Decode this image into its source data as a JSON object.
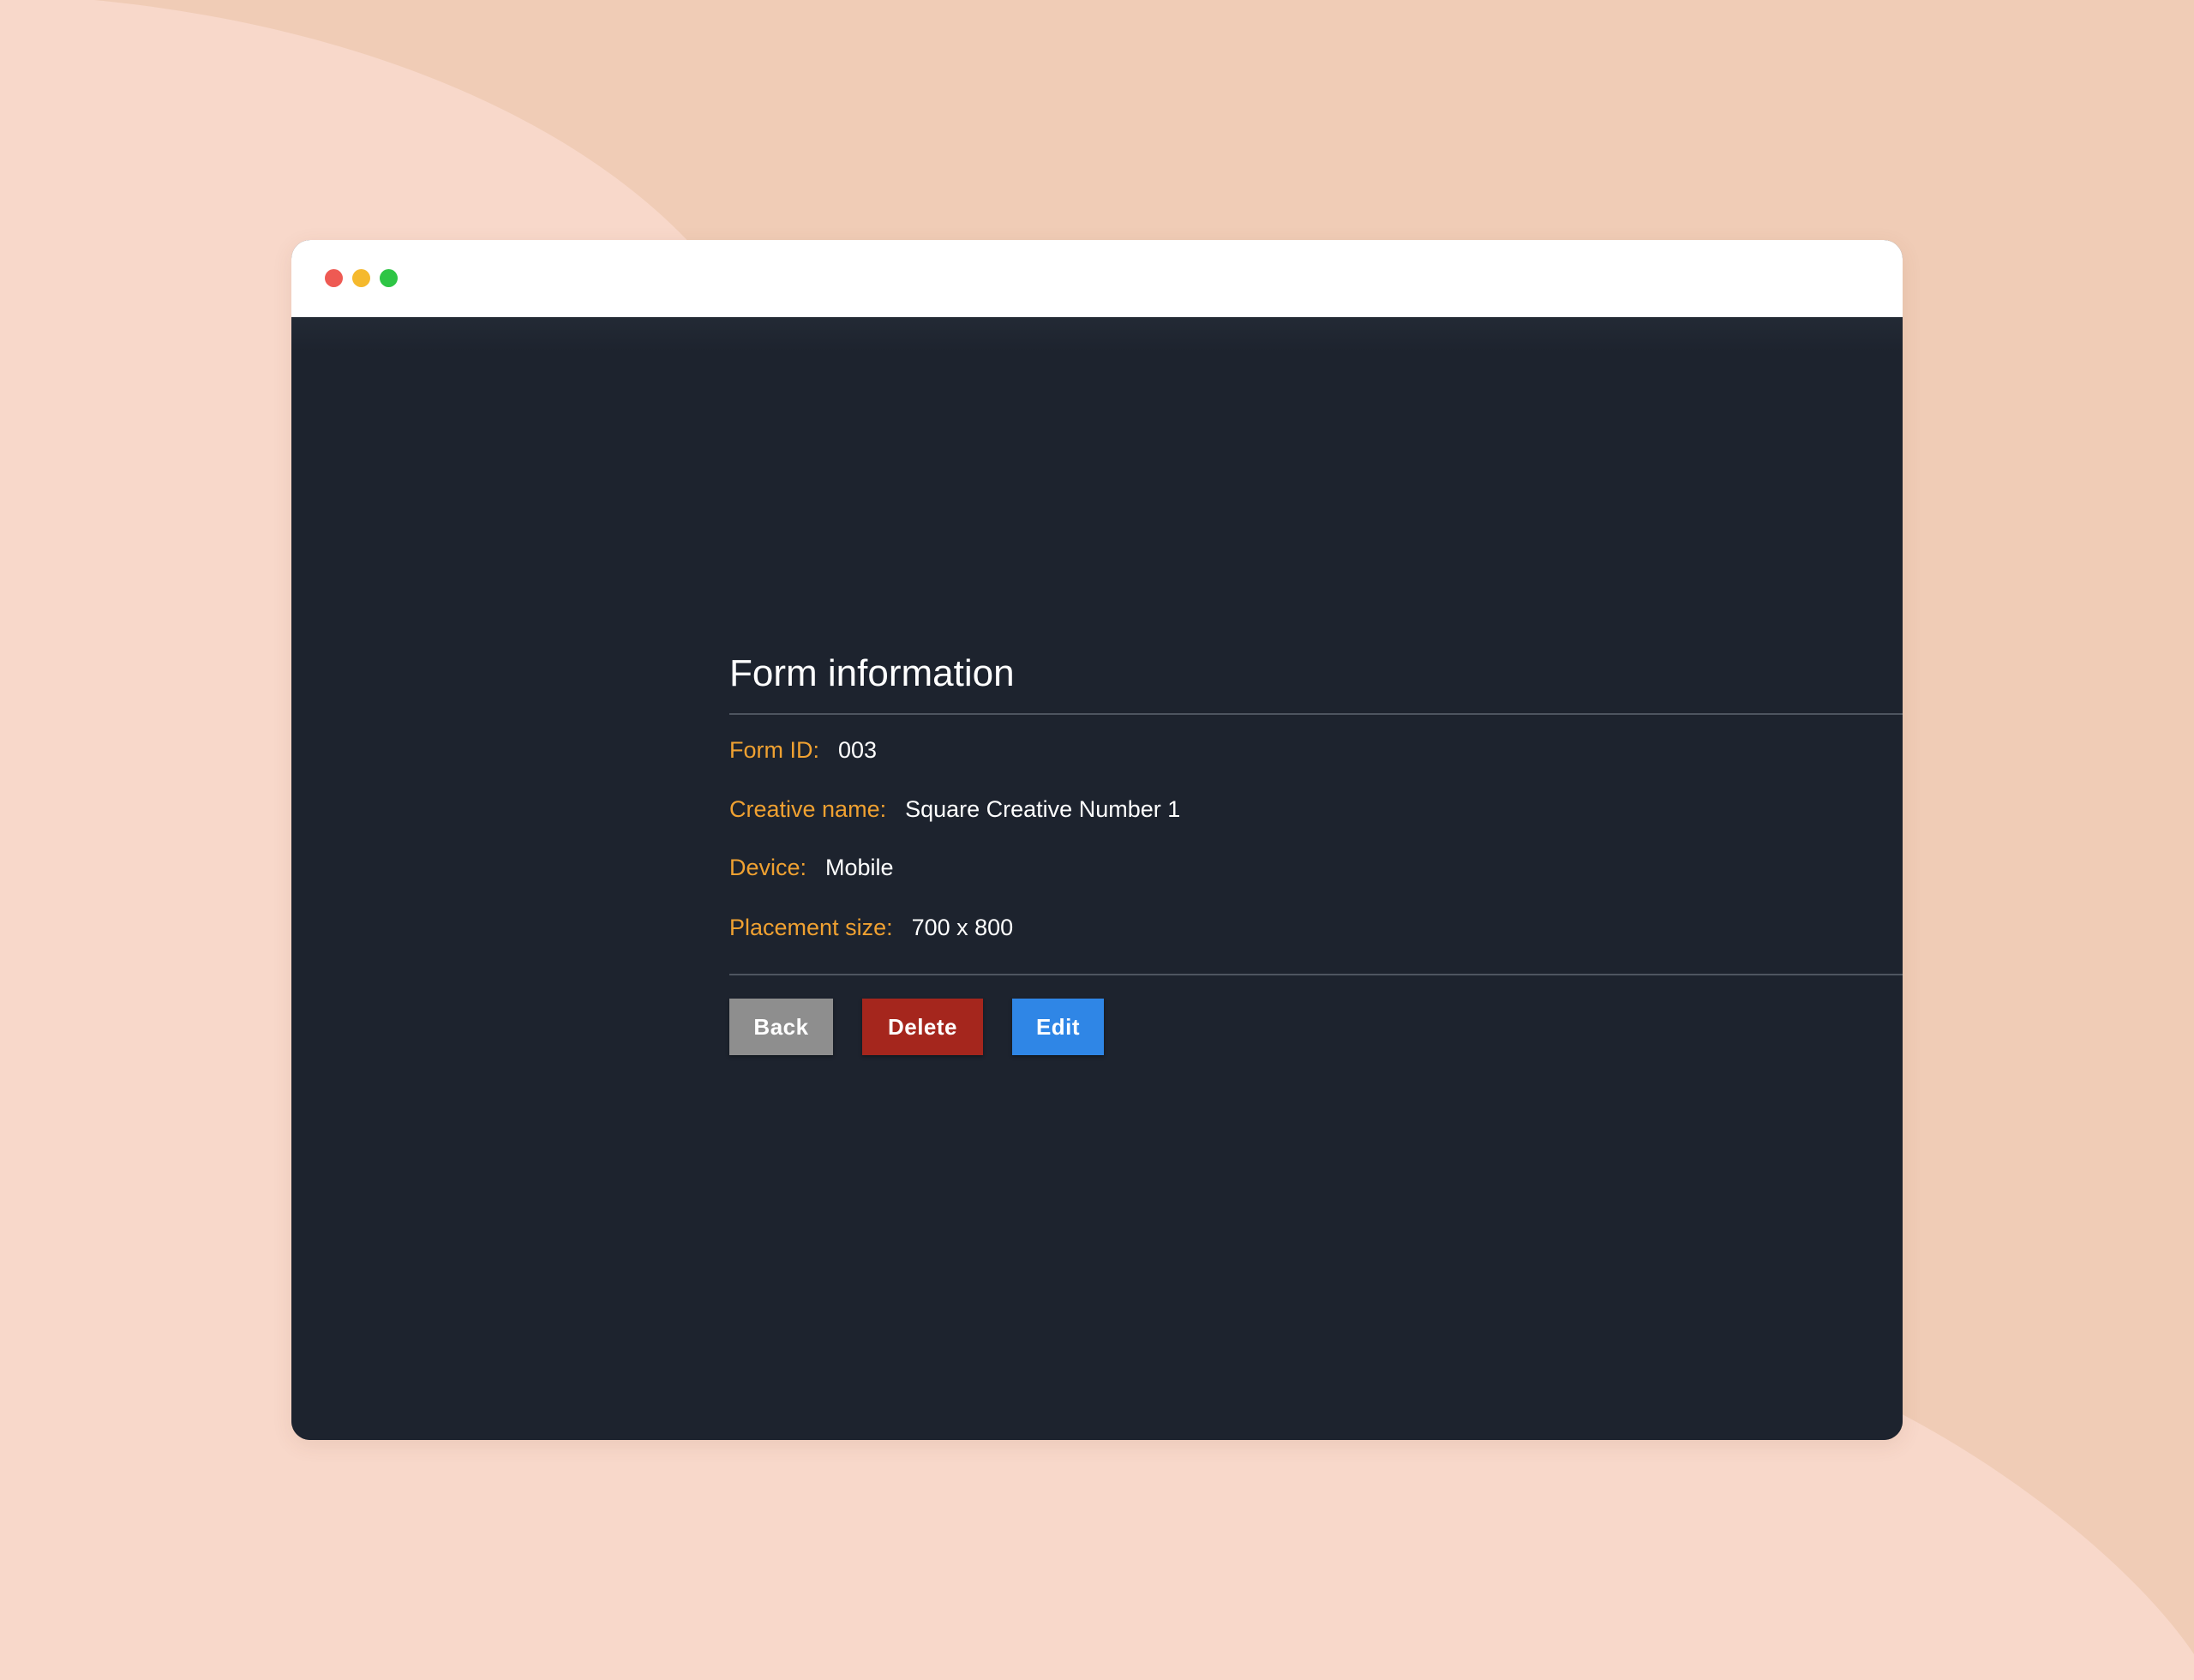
{
  "colors": {
    "page_background": "#f0ccb6",
    "page_background_light": "#f8d8ca",
    "window_titlebar": "#ffffff",
    "content_background": "#1d232e",
    "label_accent": "#f0a131",
    "value_text": "#ffffff",
    "back_button": "#8e8e8e",
    "delete_button": "#a5261d",
    "edit_button": "#2f86e6"
  },
  "window": {
    "controls": [
      "close-dot",
      "minimize-dot",
      "maximize-dot"
    ]
  },
  "form": {
    "title": "Form information",
    "fields": [
      {
        "label": "Form ID:",
        "value": "003"
      },
      {
        "label": "Creative name:",
        "value": "Square Creative Number 1"
      },
      {
        "label": "Device:",
        "value": "Mobile"
      },
      {
        "label": "Placement size:",
        "value": "700 x 800"
      }
    ]
  },
  "actions": {
    "back_label": "Back",
    "delete_label": "Delete",
    "edit_label": "Edit"
  }
}
